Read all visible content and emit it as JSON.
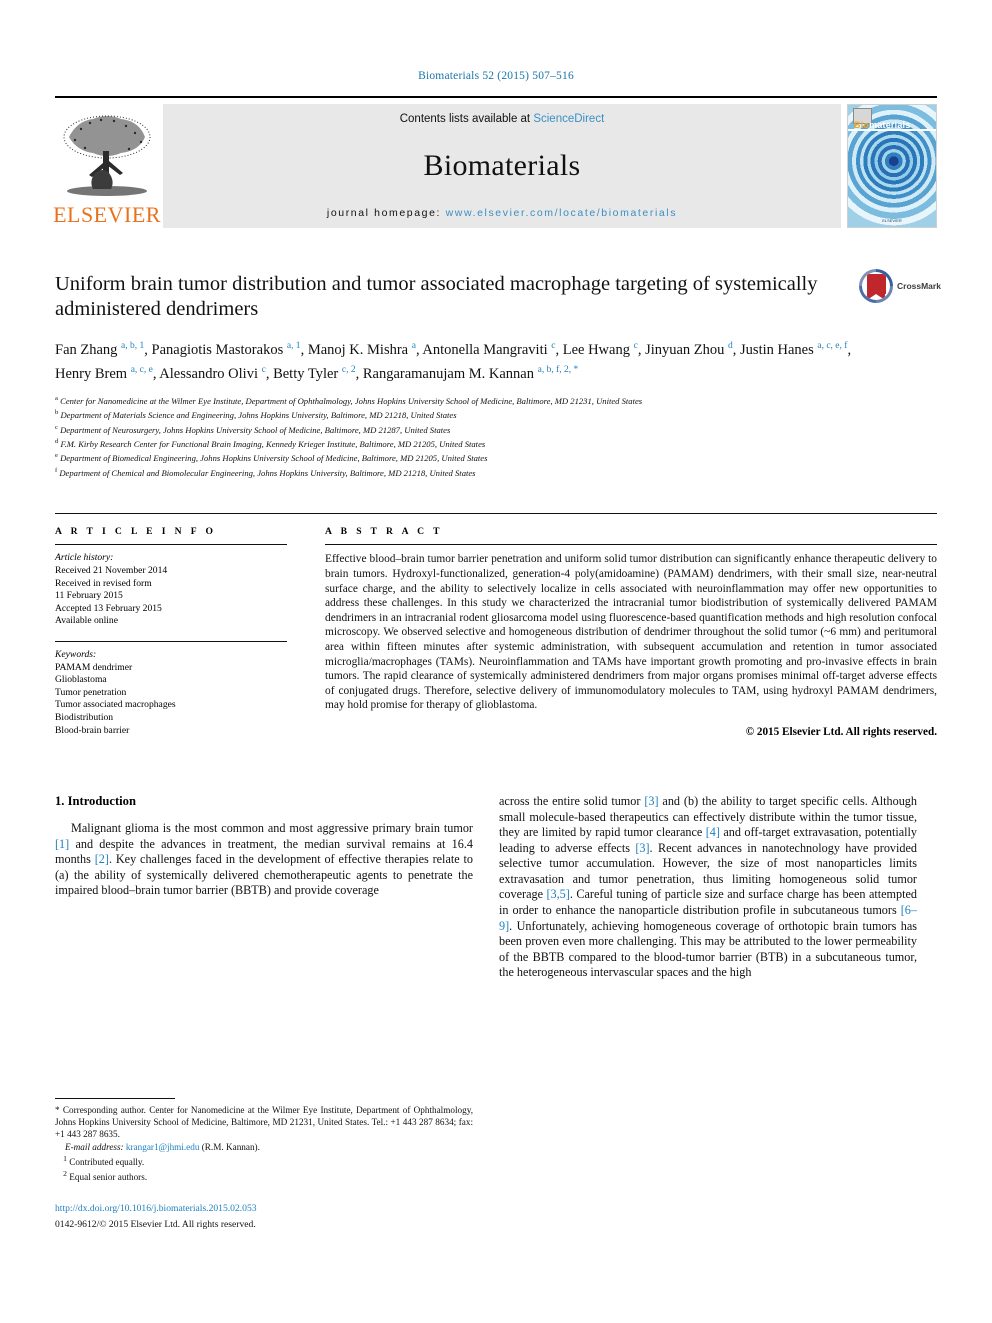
{
  "running_head": "Biomaterials 52 (2015) 507–516",
  "masthead": {
    "contents_prefix": "Contents lists available at ",
    "sciencedirect": "ScienceDirect",
    "journal_name": "Biomaterials",
    "homepage_prefix": "journal homepage: ",
    "homepage_url": "www.elsevier.com/locate/biomaterials",
    "publisher": "ELSEVIER",
    "cover": {
      "title_bio": "Bio",
      "title_materials": "materials",
      "footer": "ELSEVIER"
    },
    "accent_blue": "#3a8fc4",
    "elsevier_orange": "#E9711C"
  },
  "article": {
    "title": "Uniform brain tumor distribution and tumor associated macrophage targeting of systemically administered dendrimers",
    "crossmark_label": "CrossMark",
    "authors_html": "Fan Zhang <sup>a, b, 1</sup>, Panagiotis Mastorakos <sup>a, 1</sup>, Manoj K. Mishra <sup>a</sup>, Antonella Mangraviti <sup>c</sup>, Lee Hwang <sup>c</sup>, Jinyuan Zhou <sup>d</sup>, Justin Hanes <sup>a, c, e, f</sup>, Henry Brem <sup>a, c, e</sup>, Alessandro Olivi <sup>c</sup>, Betty Tyler <sup>c, 2</sup>, Rangaramanujam M. Kannan <sup>a, b, f, 2, *</sup>",
    "affiliations": [
      {
        "marker": "a",
        "text": "Center for Nanomedicine at the Wilmer Eye Institute, Department of Ophthalmology, Johns Hopkins University School of Medicine, Baltimore, MD 21231, United States"
      },
      {
        "marker": "b",
        "text": "Department of Materials Science and Engineering, Johns Hopkins University, Baltimore, MD 21218, United States"
      },
      {
        "marker": "c",
        "text": "Department of Neurosurgery, Johns Hopkins University School of Medicine, Baltimore, MD 21287, United States"
      },
      {
        "marker": "d",
        "text": "F.M. Kirby Research Center for Functional Brain Imaging, Kennedy Krieger Institute, Baltimore, MD 21205, United States"
      },
      {
        "marker": "e",
        "text": "Department of Biomedical Engineering, Johns Hopkins University School of Medicine, Baltimore, MD 21205, United States"
      },
      {
        "marker": "f",
        "text": "Department of Chemical and Biomolecular Engineering, Johns Hopkins University, Baltimore, MD 21218, United States"
      }
    ]
  },
  "article_info": {
    "heading": "A R T I C L E   I N F O",
    "history_label": "Article history:",
    "history": [
      "Received 21 November 2014",
      "Received in revised form",
      "11 February 2015",
      "Accepted 13 February 2015",
      "Available online"
    ],
    "keywords_label": "Keywords:",
    "keywords": [
      "PAMAM dendrimer",
      "Glioblastoma",
      "Tumor penetration",
      "Tumor associated macrophages",
      "Biodistribution",
      "Blood-brain barrier"
    ]
  },
  "abstract": {
    "heading": "A B S T R A C T",
    "text": "Effective blood–brain tumor barrier penetration and uniform solid tumor distribution can significantly enhance therapeutic delivery to brain tumors. Hydroxyl-functionalized, generation-4 poly(amidoamine) (PAMAM) dendrimers, with their small size, near-neutral surface charge, and the ability to selectively localize in cells associated with neuroinflammation may offer new opportunities to address these challenges. In this study we characterized the intracranial tumor biodistribution of systemically delivered PAMAM dendrimers in an intracranial rodent gliosarcoma model using fluorescence-based quantification methods and high resolution confocal microscopy. We observed selective and homogeneous distribution of dendrimer throughout the solid tumor (~6 mm) and peritumoral area within fifteen minutes after systemic administration, with subsequent accumulation and retention in tumor associated microglia/macrophages (TAMs). Neuroinflammation and TAMs have important growth promoting and pro-invasive effects in brain tumors. The rapid clearance of systemically administered dendrimers from major organs promises minimal off-target adverse effects of conjugated drugs. Therefore, selective delivery of immunomodulatory molecules to TAM, using hydroxyl PAMAM dendrimers, may hold promise for therapy of glioblastoma.",
    "copyright": "© 2015 Elsevier Ltd. All rights reserved."
  },
  "body": {
    "section_heading": "1.  Introduction",
    "left_paragraph_parts": [
      {
        "t": "Malignant glioma is the most common and most aggressive primary brain tumor "
      },
      {
        "t": "[1]",
        "ref": true
      },
      {
        "t": " and despite the advances in treatment, the median survival remains at 16.4 months "
      },
      {
        "t": "[2]",
        "ref": true
      },
      {
        "t": ". Key challenges faced in the development of effective therapies relate to (a) the ability of systemically delivered chemotherapeutic agents to penetrate the impaired blood–brain tumor barrier (BBTB) and provide coverage"
      }
    ],
    "right_paragraph_parts": [
      {
        "t": "across the entire solid tumor "
      },
      {
        "t": "[3]",
        "ref": true
      },
      {
        "t": " and (b) the ability to target specific cells. Although small molecule-based therapeutics can effectively distribute within the tumor tissue, they are limited by rapid tumor clearance "
      },
      {
        "t": "[4]",
        "ref": true
      },
      {
        "t": " and off-target extravasation, potentially leading to adverse effects "
      },
      {
        "t": "[3]",
        "ref": true
      },
      {
        "t": ". Recent advances in nanotechnology have provided selective tumor accumulation. However, the size of most nanoparticles limits extravasation and tumor penetration, thus limiting homogeneous solid tumor coverage "
      },
      {
        "t": "[3,5]",
        "ref": true
      },
      {
        "t": ". Careful tuning of particle size and surface charge has been attempted in order to enhance the nanoparticle distribution profile in subcutaneous tumors "
      },
      {
        "t": "[6–9]",
        "ref": true
      },
      {
        "t": ". Unfortunately, achieving homogeneous coverage of orthotopic brain tumors has been proven even more challenging. This may be attributed to the lower permeability of the BBTB compared to the blood-tumor barrier (BTB) in a subcutaneous tumor, the heterogeneous intervascular spaces and the high"
      }
    ]
  },
  "footnotes": {
    "corresponding": "* Corresponding author. Center for Nanomedicine at the Wilmer Eye Institute, Department of Ophthalmology, Johns Hopkins University School of Medicine, Baltimore, MD 21231, United States. Tel.: +1 443 287 8634; fax: +1 443 287 8635.",
    "email_label": "E-mail address:",
    "email": "krangar1@jhmi.edu",
    "email_attrib": "(R.M. Kannan).",
    "note1_num": "1",
    "note1": "Contributed equally.",
    "note2_num": "2",
    "note2": "Equal senior authors.",
    "doi": "http://dx.doi.org/10.1016/j.biomaterials.2015.02.053",
    "issn": "0142-9612/© 2015 Elsevier Ltd. All rights reserved."
  }
}
